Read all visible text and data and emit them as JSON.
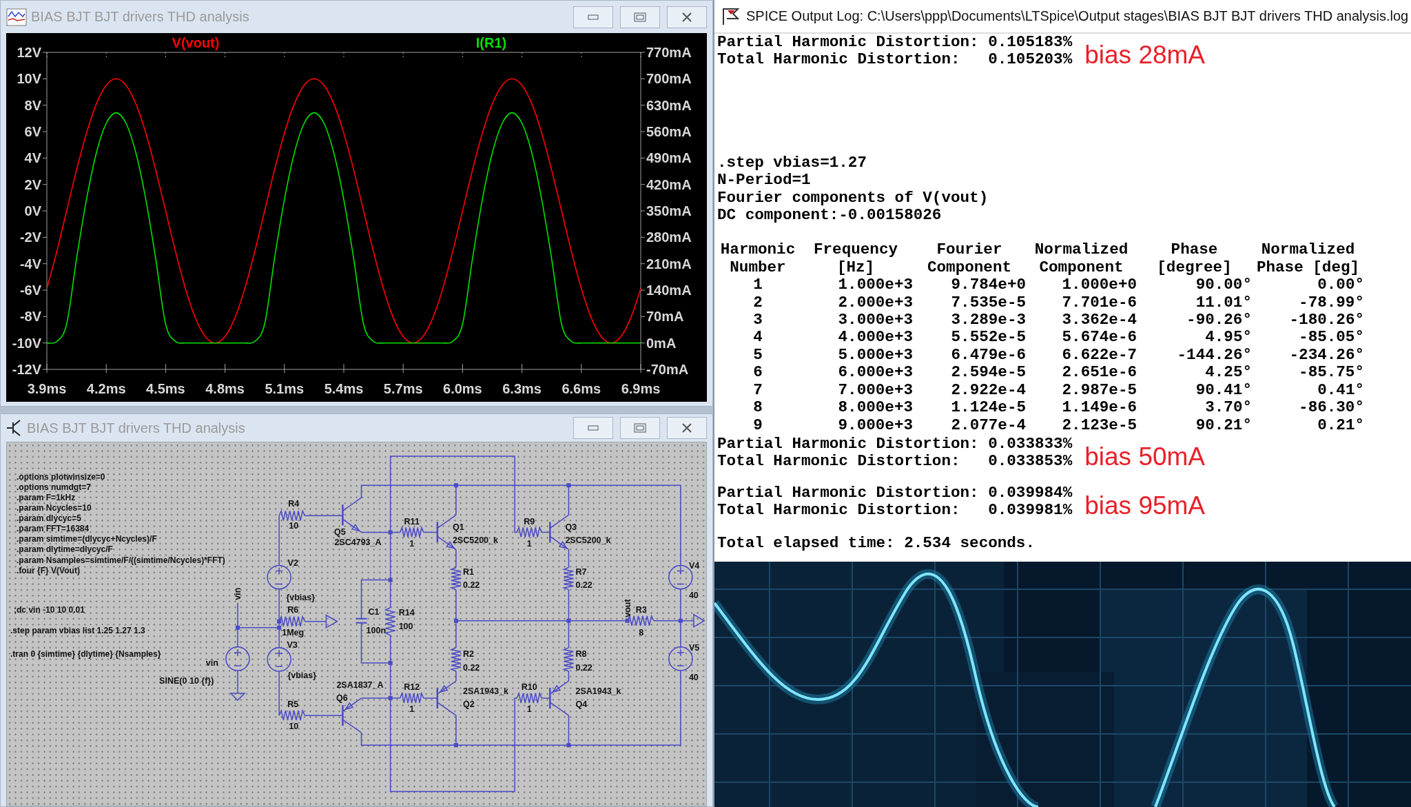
{
  "plot_window": {
    "title": "BIAS BJT BJT drivers THD analysis",
    "active": false,
    "chart_data": {
      "type": "line",
      "xlim": [
        3.9,
        6.9
      ],
      "ylim": [
        -12,
        12
      ],
      "y2lim": [
        -70,
        770
      ],
      "x": [
        3.9,
        3.95,
        4.0,
        4.05,
        4.1,
        4.15,
        4.2,
        4.25,
        4.3,
        4.35,
        4.4,
        4.45,
        4.5,
        4.55,
        4.6,
        4.65,
        4.7,
        4.75,
        4.8,
        4.85,
        4.9,
        4.95,
        5.0,
        5.05,
        5.1,
        5.15,
        5.2,
        5.25,
        5.3,
        5.35,
        5.4,
        5.45,
        5.5,
        5.55,
        5.6,
        5.65,
        5.7,
        5.75,
        5.8,
        5.85,
        5.9,
        5.95,
        6.0,
        6.05,
        6.1,
        6.15,
        6.2,
        6.25,
        6.3,
        6.35,
        6.4,
        6.45,
        6.5,
        6.55,
        6.6,
        6.65,
        6.7,
        6.75,
        6.8,
        6.85,
        6.9
      ],
      "xticks": [
        {
          "value": 3.9,
          "label": "3.9ms"
        },
        {
          "value": 4.2,
          "label": "4.2ms"
        },
        {
          "value": 4.5,
          "label": "4.5ms"
        },
        {
          "value": 4.8,
          "label": "4.8ms"
        },
        {
          "value": 5.1,
          "label": "5.1ms"
        },
        {
          "value": 5.4,
          "label": "5.4ms"
        },
        {
          "value": 5.7,
          "label": "5.7ms"
        },
        {
          "value": 6.0,
          "label": "6.0ms"
        },
        {
          "value": 6.3,
          "label": "6.3ms"
        },
        {
          "value": 6.6,
          "label": "6.6ms"
        },
        {
          "value": 6.9,
          "label": "6.9ms"
        }
      ],
      "yticks": [
        {
          "value": 12,
          "label": "12V"
        },
        {
          "value": 10,
          "label": "10V"
        },
        {
          "value": 8,
          "label": "8V"
        },
        {
          "value": 6,
          "label": "6V"
        },
        {
          "value": 4,
          "label": "4V"
        },
        {
          "value": 2,
          "label": "2V"
        },
        {
          "value": 0,
          "label": "0V"
        },
        {
          "value": -2,
          "label": "-2V"
        },
        {
          "value": -4,
          "label": "-4V"
        },
        {
          "value": -6,
          "label": "-6V"
        },
        {
          "value": -8,
          "label": "-8V"
        },
        {
          "value": -10,
          "label": "-10V"
        },
        {
          "value": -12,
          "label": "-12V"
        }
      ],
      "y2ticks": [
        {
          "value": 770,
          "label": "770mA"
        },
        {
          "value": 700,
          "label": "700mA"
        },
        {
          "value": 630,
          "label": "630mA"
        },
        {
          "value": 560,
          "label": "560mA"
        },
        {
          "value": 490,
          "label": "490mA"
        },
        {
          "value": 420,
          "label": "420mA"
        },
        {
          "value": 350,
          "label": "350mA"
        },
        {
          "value": 280,
          "label": "280mA"
        },
        {
          "value": 210,
          "label": "210mA"
        },
        {
          "value": 140,
          "label": "140mA"
        },
        {
          "value": 70,
          "label": "70mA"
        },
        {
          "value": 0,
          "label": "0mA"
        },
        {
          "value": -70,
          "label": "-70mA"
        }
      ],
      "series": [
        {
          "name": "V(vout)",
          "color": "#ff0000",
          "values": [
            -5.88,
            -3.09,
            0,
            3.09,
            5.88,
            8.09,
            9.51,
            10,
            9.51,
            8.09,
            5.88,
            3.09,
            0,
            -3.09,
            -5.88,
            -8.09,
            -9.51,
            -10,
            -9.51,
            -8.09,
            -5.88,
            -3.09,
            0,
            3.09,
            5.88,
            8.09,
            9.51,
            10,
            9.51,
            8.09,
            5.88,
            3.09,
            0,
            -3.09,
            -5.88,
            -8.09,
            -9.51,
            -10,
            -9.51,
            -8.09,
            -5.88,
            -3.09,
            0,
            3.09,
            5.88,
            8.09,
            9.51,
            10,
            9.51,
            8.09,
            5.88,
            3.09,
            0,
            -3.09,
            -5.88,
            -8.09,
            -9.51,
            -10,
            -9.51,
            -8.09,
            -5.88
          ]
        },
        {
          "name": "I(R1)",
          "color": "#00e000",
          "axis": "y2",
          "values": [
            0,
            4,
            50,
            223,
            380,
            503,
            582,
            610,
            582,
            503,
            380,
            223,
            50,
            4,
            0,
            0,
            0,
            0,
            0,
            0,
            0,
            4,
            50,
            223,
            380,
            503,
            582,
            610,
            582,
            503,
            380,
            223,
            50,
            4,
            0,
            0,
            0,
            0,
            0,
            0,
            0,
            4,
            50,
            223,
            380,
            503,
            582,
            610,
            582,
            503,
            380,
            223,
            50,
            4,
            0,
            0,
            0,
            0,
            0,
            0,
            0
          ]
        }
      ]
    }
  },
  "schematic_window": {
    "title": "BIAS BJT BJT drivers THD analysis",
    "active": false,
    "directives": [
      ".options plotwinsize=0",
      ".options numdgt=7",
      ".param F=1kHz",
      ".param Ncycles=10",
      ".param dlycyc=5",
      ".param FFT=16384",
      ".param simtime=(dlycyc+Ncycles)/F",
      ".param dlytime=dlycyc/F",
      ".param Nsamples=simtime/F/((simtime/Ncycles)*FFT)",
      ".four {F} V(Vout)",
      ";dc vin -10 10 0.01",
      ".step param vbias list 1.25 1.27 1.3",
      ".tran 0 {simtime} {dlytime} {Nsamples}"
    ],
    "components": [
      {
        "kind": "resistor",
        "ref": "R4",
        "value": "10"
      },
      {
        "kind": "npn",
        "ref": "Q5",
        "value": "2SC4793_A"
      },
      {
        "kind": "source",
        "ref": "V2",
        "value": "{vbias}"
      },
      {
        "kind": "resistor",
        "ref": "R6",
        "value": "1Meg"
      },
      {
        "kind": "source",
        "ref": "V3",
        "value": "{vbias}"
      },
      {
        "kind": "resistor",
        "ref": "R5",
        "value": "10"
      },
      {
        "kind": "pnp",
        "ref": "Q6",
        "value": "2SA1837_A"
      },
      {
        "kind": "source",
        "ref": "vin",
        "value": "SINE(0 10 {f})"
      },
      {
        "kind": "resistor",
        "ref": "R11",
        "value": "1"
      },
      {
        "kind": "npn",
        "ref": "Q1",
        "value": "2SC5200_k"
      },
      {
        "kind": "resistor",
        "ref": "R9",
        "value": "1"
      },
      {
        "kind": "npn",
        "ref": "Q3",
        "value": "2SC5200_k"
      },
      {
        "kind": "resistor",
        "ref": "R1",
        "value": "0.22"
      },
      {
        "kind": "resistor",
        "ref": "R7",
        "value": "0.22"
      },
      {
        "kind": "capacitor",
        "ref": "C1",
        "value": "100n"
      },
      {
        "kind": "resistor",
        "ref": "R14",
        "value": "100"
      },
      {
        "kind": "resistor",
        "ref": "R2",
        "value": "0.22"
      },
      {
        "kind": "resistor",
        "ref": "R8",
        "value": "0.22"
      },
      {
        "kind": "resistor",
        "ref": "R12",
        "value": "1"
      },
      {
        "kind": "pnp",
        "ref": "Q2",
        "value": "2SA1943_k"
      },
      {
        "kind": "resistor",
        "ref": "R10",
        "value": "1"
      },
      {
        "kind": "pnp",
        "ref": "Q4",
        "value": "2SA1943_k"
      },
      {
        "kind": "resistor",
        "ref": "R3",
        "value": "8"
      },
      {
        "kind": "source",
        "ref": "V4",
        "value": "40"
      },
      {
        "kind": "source",
        "ref": "V5",
        "value": "40"
      }
    ],
    "net_labels": [
      "vin",
      "vout"
    ]
  },
  "log_window": {
    "title": "SPICE Output Log: C:\\Users\\ppp\\Documents\\LTSpice\\Output stages\\BIAS BJT BJT drivers THD analysis.log",
    "active": true,
    "blocks": [
      {
        "kind": "summary",
        "lines": [
          "Partial Harmonic Distortion: 0.105183%",
          "Total Harmonic Distortion:   0.105203%"
        ],
        "note": "bias 28mA"
      },
      {
        "kind": "text",
        "lines": [
          ".step vbias=1.27",
          "N-Period=1",
          "Fourier components of V(vout)",
          "DC component:-0.00158026"
        ]
      },
      {
        "kind": "table",
        "columns": [
          "Harmonic\nNumber",
          "Frequency\n[Hz]",
          "Fourier\nComponent",
          "Normalized\nComponent",
          "Phase\n[degree]",
          "Normalized\nPhase [deg]"
        ],
        "rows": [
          [
            "1",
            "1.000e+3",
            "9.784e+0",
            "1.000e+0",
            "90.00°",
            "0.00°"
          ],
          [
            "2",
            "2.000e+3",
            "7.535e-5",
            "7.701e-6",
            "11.01°",
            "-78.99°"
          ],
          [
            "3",
            "3.000e+3",
            "3.289e-3",
            "3.362e-4",
            "-90.26°",
            "-180.26°"
          ],
          [
            "4",
            "4.000e+3",
            "5.552e-5",
            "5.674e-6",
            "4.95°",
            "-85.05°"
          ],
          [
            "5",
            "5.000e+3",
            "6.479e-6",
            "6.622e-7",
            "-144.26°",
            "-234.26°"
          ],
          [
            "6",
            "6.000e+3",
            "2.594e-5",
            "2.651e-6",
            "4.25°",
            "-85.75°"
          ],
          [
            "7",
            "7.000e+3",
            "2.922e-4",
            "2.987e-5",
            "90.41°",
            "0.41°"
          ],
          [
            "8",
            "8.000e+3",
            "1.124e-5",
            "1.149e-6",
            "3.70°",
            "-86.30°"
          ],
          [
            "9",
            "9.000e+3",
            "2.077e-4",
            "2.123e-5",
            "90.21°",
            "0.21°"
          ]
        ]
      },
      {
        "kind": "summary",
        "lines": [
          "Partial Harmonic Distortion: 0.033833%",
          "Total Harmonic Distortion:   0.033853%"
        ],
        "note": "bias 50mA"
      },
      {
        "kind": "summary",
        "lines": [
          "Partial Harmonic Distortion: 0.039984%",
          "Total Harmonic Distortion:   0.039981%"
        ],
        "note": "bias 95mA"
      },
      {
        "kind": "text",
        "lines": [
          "Total elapsed time: 2.534 seconds."
        ]
      }
    ]
  }
}
